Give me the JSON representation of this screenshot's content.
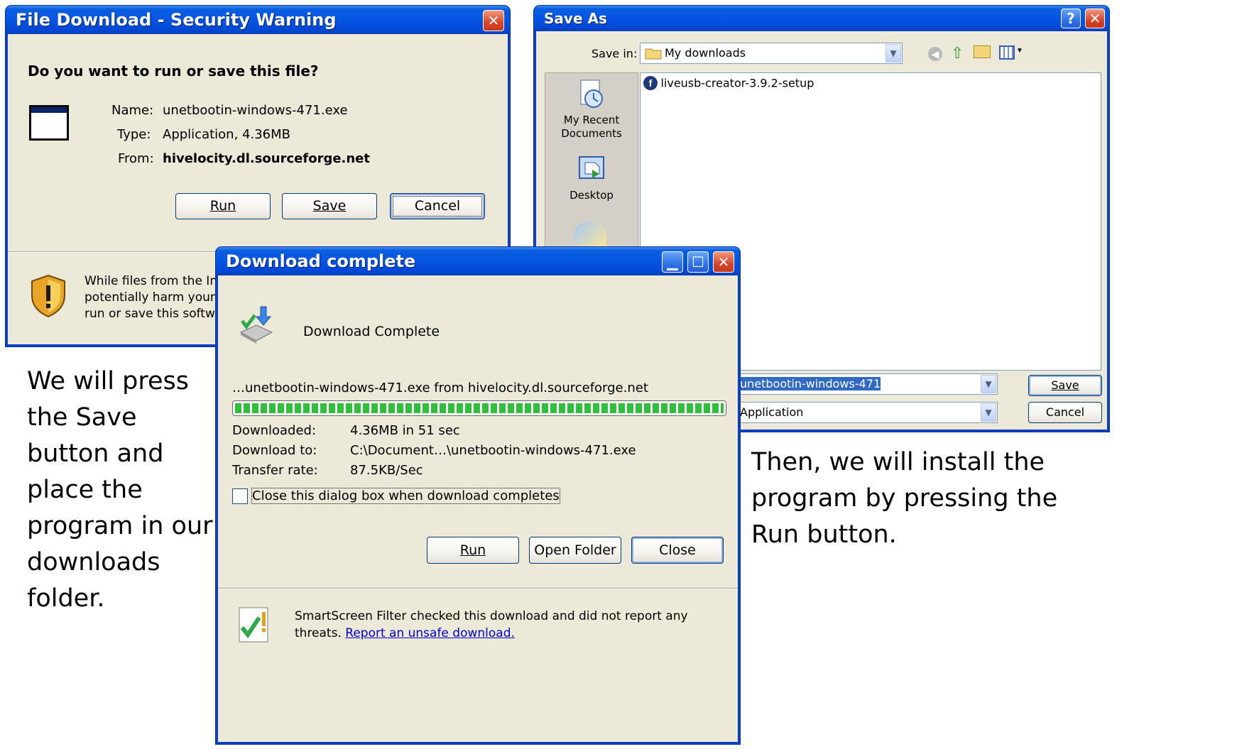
{
  "security_dialog": {
    "title": "File Download - Security Warning",
    "question": "Do you want to run or save this file?",
    "name_label": "Name:",
    "name_value": "unetbootin-windows-471.exe",
    "type_label": "Type:",
    "type_value": "Application, 4.36MB",
    "from_label": "From:",
    "from_value": "hivelocity.dl.sourceforge.net",
    "run_label": "Run",
    "save_label": "Save",
    "cancel_label": "Cancel",
    "warning_line1": "While files from the Int",
    "warning_line2": "potentially harm your c",
    "warning_line3": "run or save this softwa",
    "close_glyph": "✕"
  },
  "save_as_dialog": {
    "title": "Save As",
    "save_in_label": "Save in:",
    "save_in_value": "My downloads",
    "places": [
      {
        "label": "My Recent\nDocuments",
        "icon": "recent-documents-icon"
      },
      {
        "label": "Desktop",
        "icon": "desktop-icon"
      }
    ],
    "files": [
      {
        "name": "liveusb-creator-3.9.2-setup",
        "icon": "fedora-icon"
      }
    ],
    "filename_value": "unetbootin-windows-471",
    "filetype_value": "Application",
    "save_label": "Save",
    "cancel_label": "Cancel",
    "help_glyph": "?",
    "close_glyph": "✕"
  },
  "download_dialog": {
    "title": "Download complete",
    "heading": "Download Complete",
    "source_line": "…unetbootin-windows-471.exe from hivelocity.dl.sourceforge.net",
    "progress": 1.0,
    "downloaded_label": "Downloaded:",
    "downloaded_value": "4.36MB in 51 sec",
    "download_to_label": "Download to:",
    "download_to_value": "C:\\Document…\\unetbootin-windows-471.exe",
    "transfer_rate_label": "Transfer rate:",
    "transfer_rate_value": "87.5KB/Sec",
    "checkbox_label": "Close this dialog box when download completes",
    "checkbox_checked": false,
    "run_label": "Run",
    "open_folder_label": "Open Folder",
    "close_label": "Close",
    "smartscreen_text": "SmartScreen Filter checked this download and did not report any",
    "smartscreen_text2": "threats.",
    "report_link": "Report an unsafe download.",
    "close_glyph": "✕"
  },
  "captions": {
    "left": [
      "We will press",
      "the Save",
      "button and",
      "place the",
      "program in our",
      "downloads",
      "folder."
    ],
    "right": [
      "Then, we will install the",
      "program by pressing the",
      "Run button."
    ]
  },
  "colors": {
    "title_blue": "#0554e3",
    "dialog_face": "#ece9d8",
    "progress_green": "#2fbf3a",
    "link_blue": "#0000cc"
  }
}
